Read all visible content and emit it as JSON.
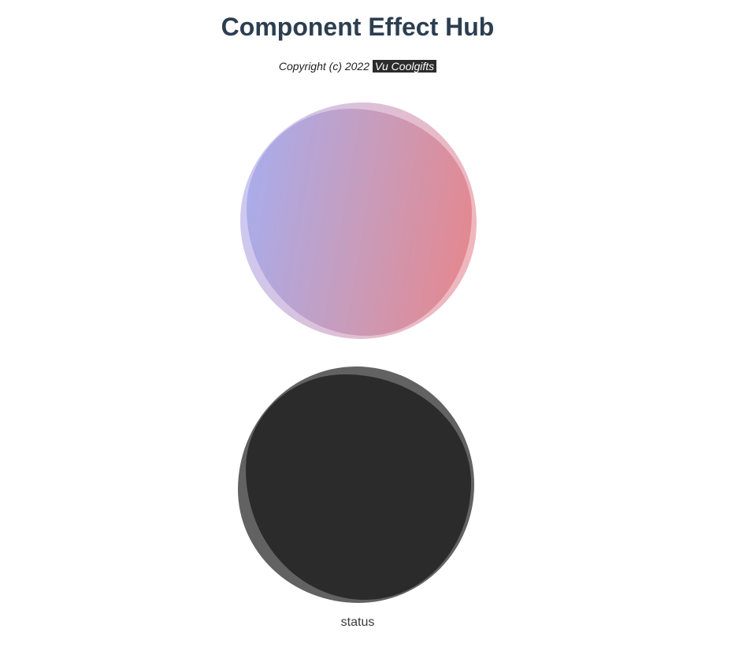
{
  "header": {
    "title": "Component Effect Hub",
    "copyright_prefix": "Copyright (c) 2022",
    "author": "Vu Coolgifts"
  },
  "blobs": {
    "gradient": {
      "colors": [
        "#a3a7ea",
        "#c396b7",
        "#e67d82"
      ]
    },
    "dark": {
      "colors": [
        "#5a5a5a",
        "#2b2b2b"
      ]
    }
  },
  "status": {
    "label": "status"
  }
}
